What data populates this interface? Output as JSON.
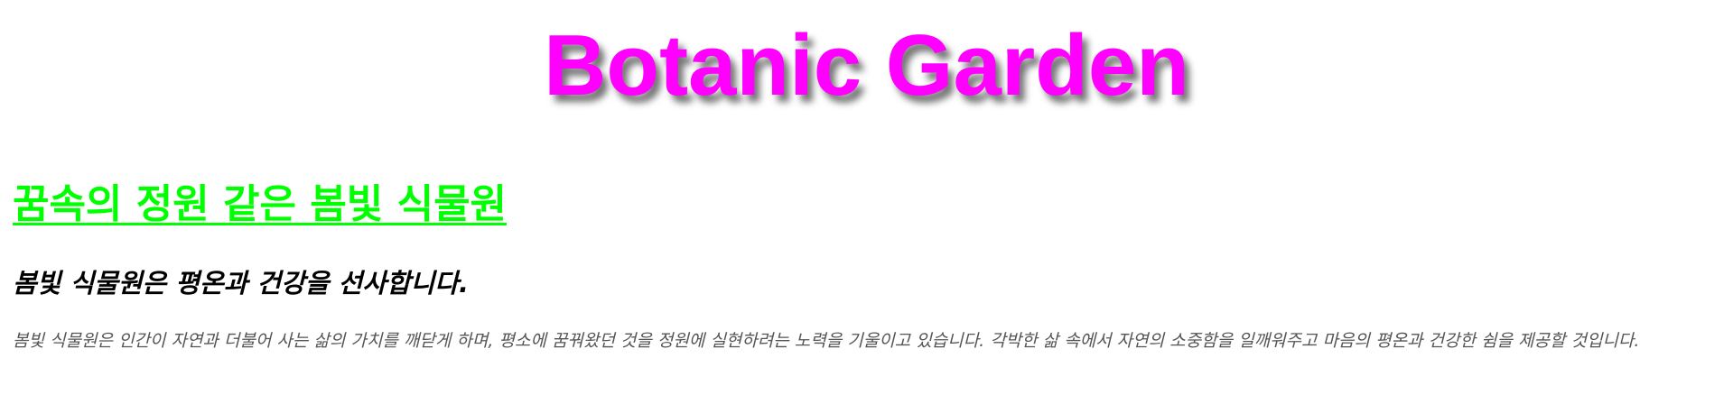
{
  "header": {
    "title": "Botanic Garden",
    "title_color": "#ff00ff"
  },
  "section": {
    "heading": "꿈속의 정원 같은 봄빛 식물원",
    "heading_color": "#00ff00",
    "subheading": "봄빛 식물원은 평온과 건강을 선사합니다.",
    "paragraph": "봄빛 식물원은 인간이 자연과 더불어 사는 삶의 가치를 깨닫게 하며, 평소에 꿈꿔왔던 것을 정원에 실현하려는 노력을 기울이고 있습니다. 각박한 삶 속에서 자연의 소중함을 일깨워주고 마음의 평온과 건강한 쉼을 제공할 것입니다."
  }
}
